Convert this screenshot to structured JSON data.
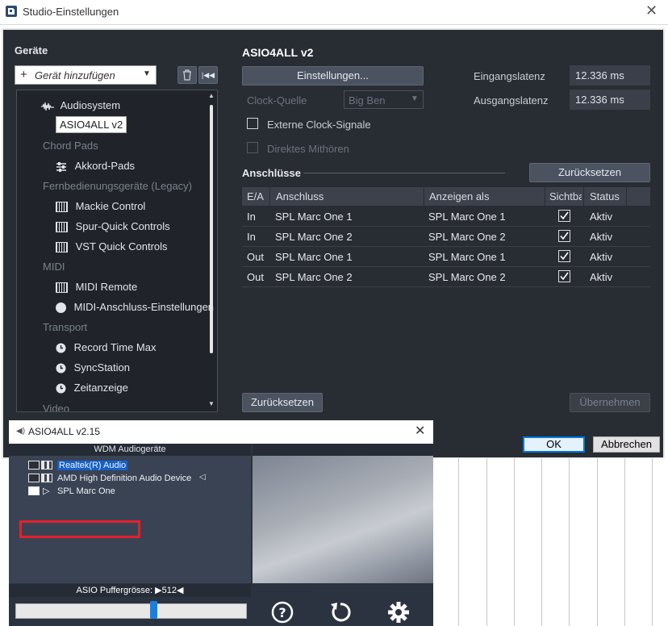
{
  "window": {
    "title": "Studio-Einstellungen"
  },
  "left_panel": {
    "heading": "Geräte",
    "add_device_label": "Gerät hinzufügen",
    "tree": [
      {
        "label": "Audiosystem",
        "kind": "item",
        "icon": "waveform-icon"
      },
      {
        "label": "ASIO4ALL v2",
        "kind": "selected"
      },
      {
        "label": "Chord Pads",
        "kind": "category"
      },
      {
        "label": "Akkord-Pads",
        "kind": "item",
        "icon": "sliders-icon"
      },
      {
        "label": "Fernbedienungsgeräte (Legacy)",
        "kind": "category"
      },
      {
        "label": "Mackie Control",
        "kind": "item",
        "icon": "keyboard-icon"
      },
      {
        "label": "Spur-Quick Controls",
        "kind": "item",
        "icon": "keyboard-icon"
      },
      {
        "label": "VST Quick Controls",
        "kind": "item",
        "icon": "keyboard-icon"
      },
      {
        "label": "MIDI",
        "kind": "category"
      },
      {
        "label": "MIDI Remote",
        "kind": "item",
        "icon": "keyboard-icon"
      },
      {
        "label": "MIDI-Anschluss-Einstellungen",
        "kind": "item",
        "icon": "midi-port-icon"
      },
      {
        "label": "Transport",
        "kind": "category"
      },
      {
        "label": "Record Time Max",
        "kind": "item",
        "icon": "clock-icon"
      },
      {
        "label": "SyncStation",
        "kind": "item",
        "icon": "clock-icon"
      },
      {
        "label": "Zeitanzeige",
        "kind": "item",
        "icon": "clock-icon"
      },
      {
        "label": "Video",
        "kind": "category"
      }
    ]
  },
  "right_panel": {
    "heading": "ASIO4ALL v2",
    "settings_button": "Einstellungen...",
    "clock_source_label": "Clock-Quelle",
    "clock_source_value": "Big Ben",
    "input_latency_label": "Eingangslatenz",
    "input_latency_value": "12.336 ms",
    "output_latency_label": "Ausgangslatenz",
    "output_latency_value": "12.336 ms",
    "external_clock_label": "Externe Clock-Signale",
    "direct_monitor_label": "Direktes Mithören",
    "ports_heading": "Anschlüsse",
    "reset_ports_button": "Zurücksetzen",
    "columns": [
      "E/A",
      "Anschluss",
      "Anzeigen als",
      "Sichtba",
      "Status"
    ],
    "rows": [
      {
        "io": "In",
        "port": "SPL Marc One  1",
        "show_as": "SPL Marc One  1",
        "visible": true,
        "status": "Aktiv"
      },
      {
        "io": "In",
        "port": "SPL Marc One  2",
        "show_as": "SPL Marc One  2",
        "visible": true,
        "status": "Aktiv"
      },
      {
        "io": "Out",
        "port": "SPL Marc One  1",
        "show_as": "SPL Marc One  1",
        "visible": true,
        "status": "Aktiv"
      },
      {
        "io": "Out",
        "port": "SPL Marc One  2",
        "show_as": "SPL Marc One  2",
        "visible": true,
        "status": "Aktiv"
      }
    ],
    "reset_button": "Zurücksetzen",
    "apply_button": "Übernehmen"
  },
  "footer": {
    "ok_button": "OK",
    "cancel_button": "Abbrechen"
  },
  "asio": {
    "title": "ASIO4ALL v2.15",
    "devices_header": "WDM Audiogeräte",
    "devices": [
      {
        "name": "Realtek(R) Audio",
        "selected": true
      },
      {
        "name": "AMD High Definition Audio Device",
        "speaker": true
      },
      {
        "name": "SPL Marc One",
        "highlighted": true
      }
    ],
    "buffer_label": "ASIO Puffergrösse: ▶512◀",
    "buffer_slider_fraction": 0.6
  },
  "colors": {
    "accent": "#1560c9",
    "highlight_box": "#e4202a",
    "panel_bg": "#282c33"
  }
}
